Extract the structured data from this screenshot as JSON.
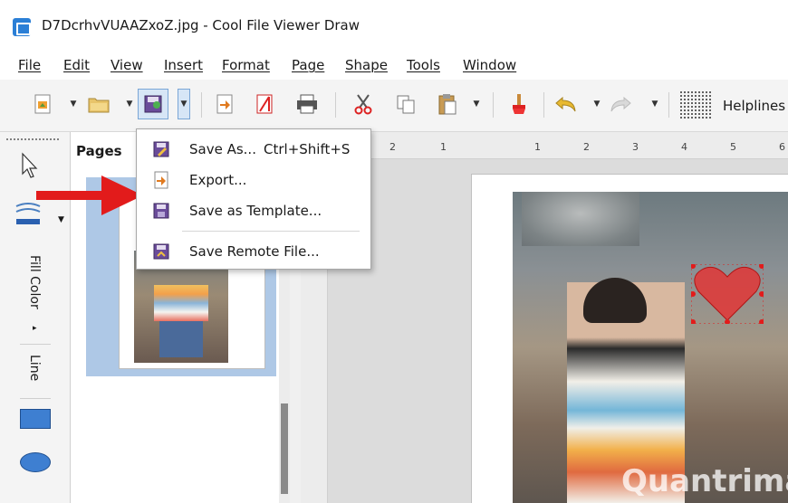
{
  "window": {
    "title": "D7DcrhvVUAAZxoZ.jpg - Cool File Viewer Draw"
  },
  "menubar": {
    "items": [
      "File",
      "Edit",
      "View",
      "Insert",
      "Format",
      "Page",
      "Shape",
      "Tools",
      "Window"
    ]
  },
  "toolbar": {
    "helplines_label": "Helplines"
  },
  "left_toolbar": {
    "fill_color_label": "Fill Color",
    "line_label": "Line"
  },
  "pages_panel": {
    "title": "Pages"
  },
  "ruler": {
    "labels": [
      "2",
      "1",
      "1",
      "2",
      "3",
      "4",
      "5",
      "6"
    ]
  },
  "save_menu": {
    "save_as": {
      "label": "Save As...",
      "shortcut": "Ctrl+Shift+S"
    },
    "export": {
      "label": "Export..."
    },
    "save_as_template": {
      "label": "Save as Template..."
    },
    "save_remote": {
      "label": "Save Remote File..."
    }
  },
  "watermark": {
    "text": "Quantrimang"
  },
  "colors": {
    "selection_blue": "#aec8e6",
    "accent_red": "#e21b1b",
    "menu_border": "#a8a8a8"
  }
}
